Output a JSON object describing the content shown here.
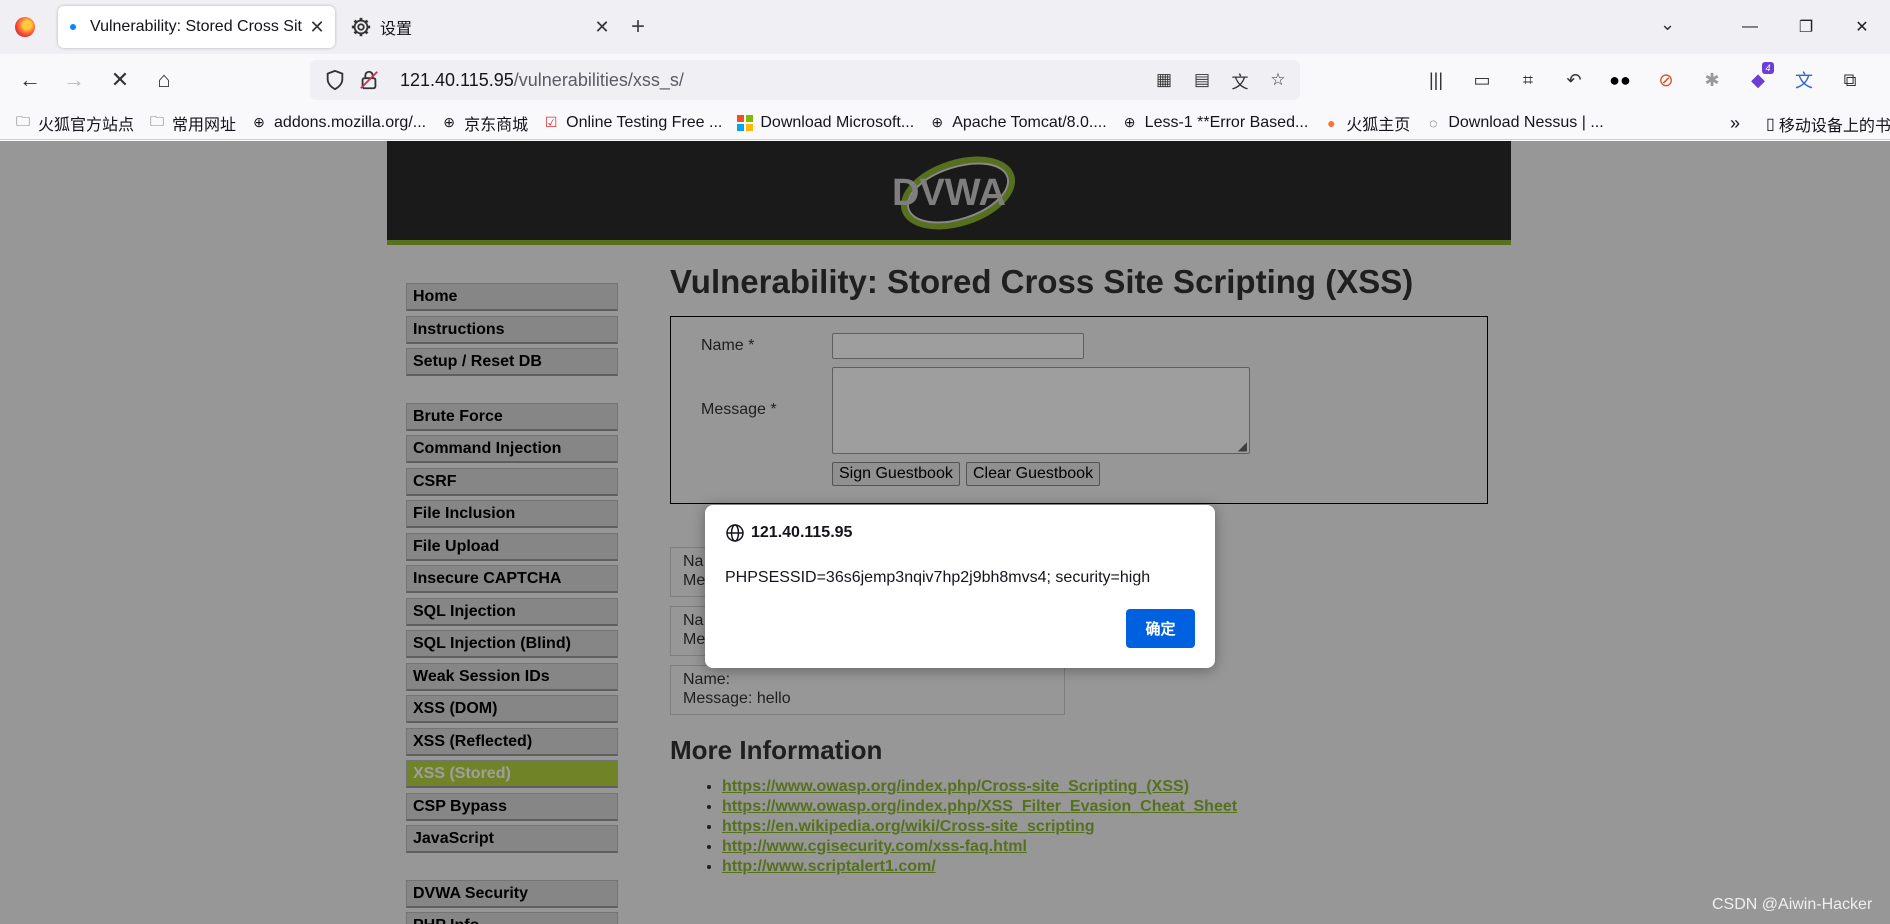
{
  "browser": {
    "tabs": [
      {
        "title": "Vulnerability: Stored Cross Sit",
        "active": true
      },
      {
        "title": "设置",
        "active": false
      }
    ],
    "url_host": "121.40.115.95",
    "url_path": "/vulnerabilities/xss_s/",
    "bookmarks": [
      {
        "label": "火狐官方站点",
        "icon": "folder-icon"
      },
      {
        "label": "常用网址",
        "icon": "folder-icon"
      },
      {
        "label": "addons.mozilla.org/...",
        "icon": "globe-icon"
      },
      {
        "label": "京东商城",
        "icon": "globe-icon"
      },
      {
        "label": "Online Testing Free ...",
        "icon": "checkbox-icon"
      },
      {
        "label": "Download Microsoft...",
        "icon": "microsoft-icon"
      },
      {
        "label": "Apache Tomcat/8.0....",
        "icon": "globe-icon"
      },
      {
        "label": "Less-1 **Error Based...",
        "icon": "globe-icon"
      },
      {
        "label": "火狐主页",
        "icon": "firefox-icon"
      },
      {
        "label": "Download Nessus | ...",
        "icon": "nessus-icon"
      }
    ],
    "bookmark_mobile": "移动设备上的书"
  },
  "menu": {
    "group1": [
      "Home",
      "Instructions",
      "Setup / Reset DB"
    ],
    "group2": [
      "Brute Force",
      "Command Injection",
      "CSRF",
      "File Inclusion",
      "File Upload",
      "Insecure CAPTCHA",
      "SQL Injection",
      "SQL Injection (Blind)",
      "Weak Session IDs",
      "XSS (DOM)",
      "XSS (Reflected)",
      "XSS (Stored)",
      "CSP Bypass",
      "JavaScript"
    ],
    "group3": [
      "DVWA Security",
      "PHP Info"
    ],
    "selected": "XSS (Stored)"
  },
  "main": {
    "title": "Vulnerability: Stored Cross Site Scripting (XSS)",
    "name_label": "Name *",
    "message_label": "Message *",
    "sign_button": "Sign Guestbook",
    "clear_button": "Clear Guestbook",
    "entries": [
      {
        "name": "Na",
        "message": "Me"
      },
      {
        "name": "Na",
        "message": "Me"
      },
      {
        "name": "Name:",
        "message": "Message: hello"
      }
    ],
    "more_title": "More Information",
    "links": [
      "https://www.owasp.org/index.php/Cross-site_Scripting_(XSS)",
      "https://www.owasp.org/index.php/XSS_Filter_Evasion_Cheat_Sheet",
      "https://en.wikipedia.org/wiki/Cross-site_scripting",
      "http://www.cgisecurity.com/xss-faq.html",
      "http://www.scriptalert1.com/"
    ]
  },
  "dialog": {
    "origin": "121.40.115.95",
    "message": "PHPSESSID=36s6jemp3nqiv7hp2j9bh8mvs4; security=high",
    "ok_label": "确定"
  },
  "watermark": "CSDN @Aiwin-Hacker",
  "colors": {
    "dvwa_green": "#8bb531",
    "selected_menu": "#b5d33f",
    "ok_blue": "#0061e0"
  }
}
